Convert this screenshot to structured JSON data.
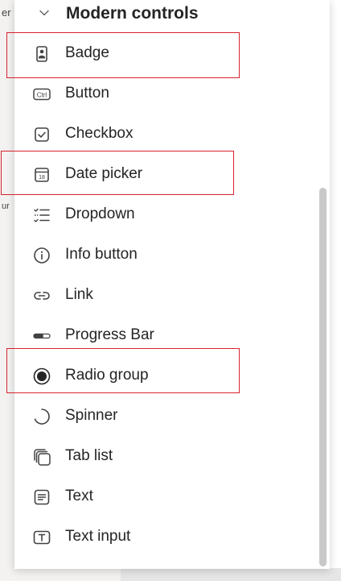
{
  "background": {
    "stub_top": "er",
    "stub_mid": "ur"
  },
  "section": {
    "title": "Modern controls",
    "expanded": true
  },
  "items": [
    {
      "label": "Badge",
      "icon": "badge-icon"
    },
    {
      "label": "Button",
      "icon": "button-ctrl-icon"
    },
    {
      "label": "Checkbox",
      "icon": "checkbox-icon"
    },
    {
      "label": "Date picker",
      "icon": "calendar-icon"
    },
    {
      "label": "Dropdown",
      "icon": "dropdown-list-icon"
    },
    {
      "label": "Info button",
      "icon": "info-icon"
    },
    {
      "label": "Link",
      "icon": "link-icon"
    },
    {
      "label": "Progress Bar",
      "icon": "progress-bar-icon"
    },
    {
      "label": "Radio group",
      "icon": "radio-icon"
    },
    {
      "label": "Spinner",
      "icon": "spinner-icon"
    },
    {
      "label": "Tab list",
      "icon": "tab-list-icon"
    },
    {
      "label": "Text",
      "icon": "text-icon"
    },
    {
      "label": "Text input",
      "icon": "text-input-icon"
    }
  ],
  "highlight_color": "#d6232f"
}
